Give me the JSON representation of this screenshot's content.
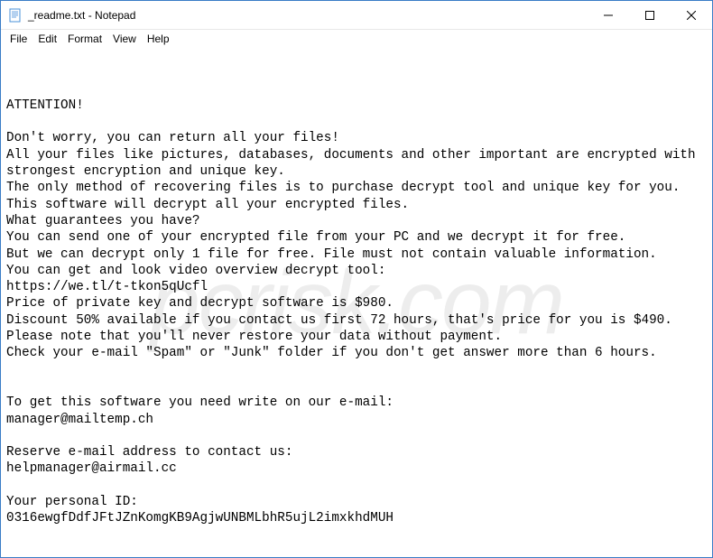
{
  "titlebar": {
    "title": "_readme.txt - Notepad"
  },
  "menu": {
    "file": "File",
    "edit": "Edit",
    "format": "Format",
    "view": "View",
    "help": "Help"
  },
  "watermark": "pcrisk.com",
  "content": "ATTENTION!\n\nDon't worry, you can return all your files!\nAll your files like pictures, databases, documents and other important are encrypted with strongest encryption and unique key.\nThe only method of recovering files is to purchase decrypt tool and unique key for you.\nThis software will decrypt all your encrypted files.\nWhat guarantees you have?\nYou can send one of your encrypted file from your PC and we decrypt it for free.\nBut we can decrypt only 1 file for free. File must not contain valuable information.\nYou can get and look video overview decrypt tool:\nhttps://we.tl/t-tkon5qUcfl\nPrice of private key and decrypt software is $980.\nDiscount 50% available if you contact us first 72 hours, that's price for you is $490.\nPlease note that you'll never restore your data without payment.\nCheck your e-mail \"Spam\" or \"Junk\" folder if you don't get answer more than 6 hours.\n\n\nTo get this software you need write on our e-mail:\nmanager@mailtemp.ch\n\nReserve e-mail address to contact us:\nhelpmanager@airmail.cc\n\nYour personal ID:\n0316ewgfDdfJFtJZnKomgKB9AgjwUNBMLbhR5ujL2imxkhdMUH"
}
